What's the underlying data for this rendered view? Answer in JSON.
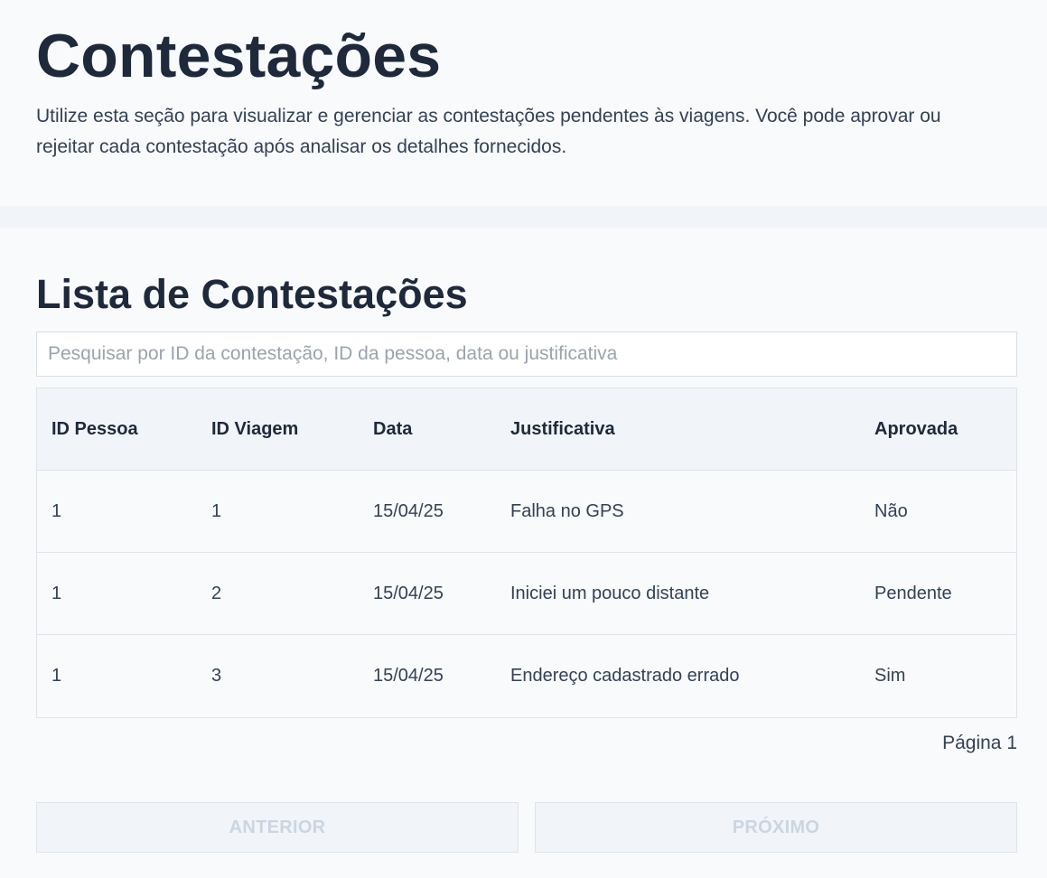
{
  "header": {
    "title": "Contestações",
    "description": "Utilize esta seção para visualizar e gerenciar as contestações pendentes às viagens. Você pode aprovar ou rejeitar cada contestação após analisar os detalhes fornecidos."
  },
  "list": {
    "title": "Lista de Contestações",
    "search": {
      "placeholder": "Pesquisar por ID da contestação, ID da pessoa, data ou justificativa",
      "value": ""
    },
    "columns": [
      "ID Pessoa",
      "ID Viagem",
      "Data",
      "Justificativa",
      "Aprovada"
    ],
    "rows": [
      [
        "1",
        "1",
        "15/04/25",
        "Falha no GPS",
        "Não"
      ],
      [
        "1",
        "2",
        "15/04/25",
        "Iniciei um pouco distante",
        "Pendente"
      ],
      [
        "1",
        "3",
        "15/04/25",
        "Endereço cadastrado errado",
        "Sim"
      ]
    ],
    "pagination": {
      "label": "Página 1",
      "previous_label": "ANTERIOR",
      "next_label": "PRÓXIMO"
    }
  },
  "colors": {
    "background": "#f8fafc",
    "band": "#f1f5f9",
    "text_primary": "#1e293b",
    "text_secondary": "#334155",
    "border": "#dfe4ea",
    "disabled_text": "#cbd5e1"
  }
}
